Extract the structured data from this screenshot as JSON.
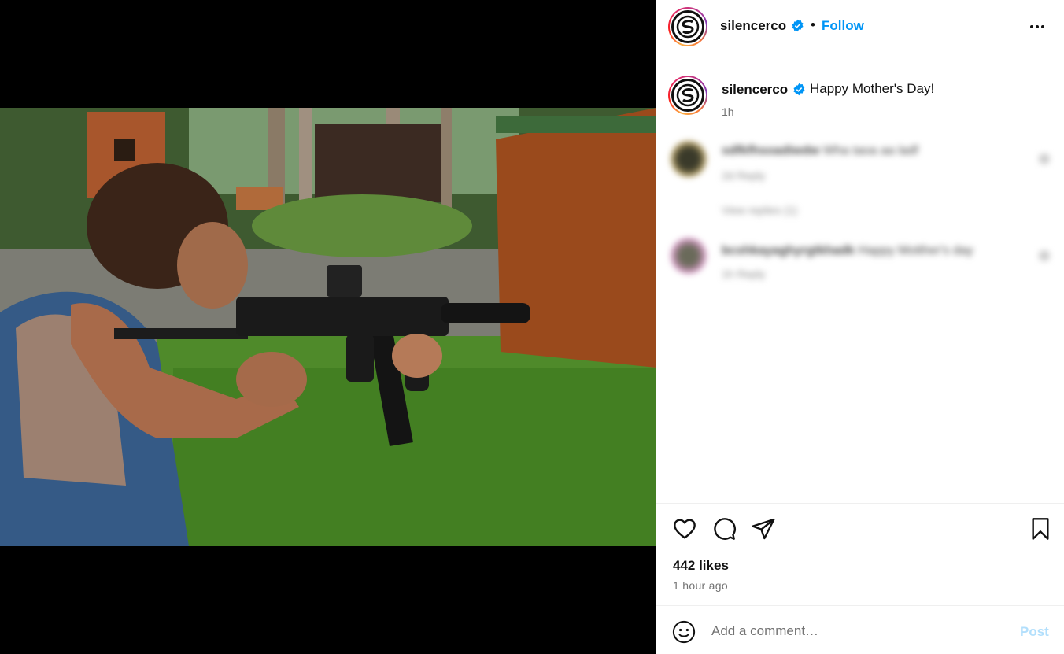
{
  "post": {
    "image_alt": "Woman aiming a suppressed submachine gun outdoors near wooden sheds",
    "author": {
      "username": "silencerco",
      "verified": true
    },
    "follow_label": "Follow",
    "separator": "•",
    "caption": "Happy Mother's Day!",
    "caption_time": "1h",
    "comments": [
      {
        "username": "sdfkfhsoadiwdw",
        "text": "Wha taoa aa ladf",
        "meta": "2d  Reply",
        "replies": "View replies (1)"
      },
      {
        "username": "bcshkayaghyrgtkhadk",
        "text": "Happy Motther's day",
        "meta": "1h  Reply"
      }
    ],
    "likes": "442 likes",
    "posted": "1 hour ago",
    "comment_placeholder": "Add a comment…",
    "post_label": "Post"
  },
  "colors": {
    "link": "#0095f6",
    "post_disabled": "#b2dffc",
    "muted": "#737373"
  },
  "icons": {
    "more": "more-options-icon",
    "like": "heart-icon",
    "comment": "comment-icon",
    "share": "share-icon",
    "save": "bookmark-icon",
    "emoji": "emoji-icon",
    "verified": "verified-badge-icon"
  }
}
